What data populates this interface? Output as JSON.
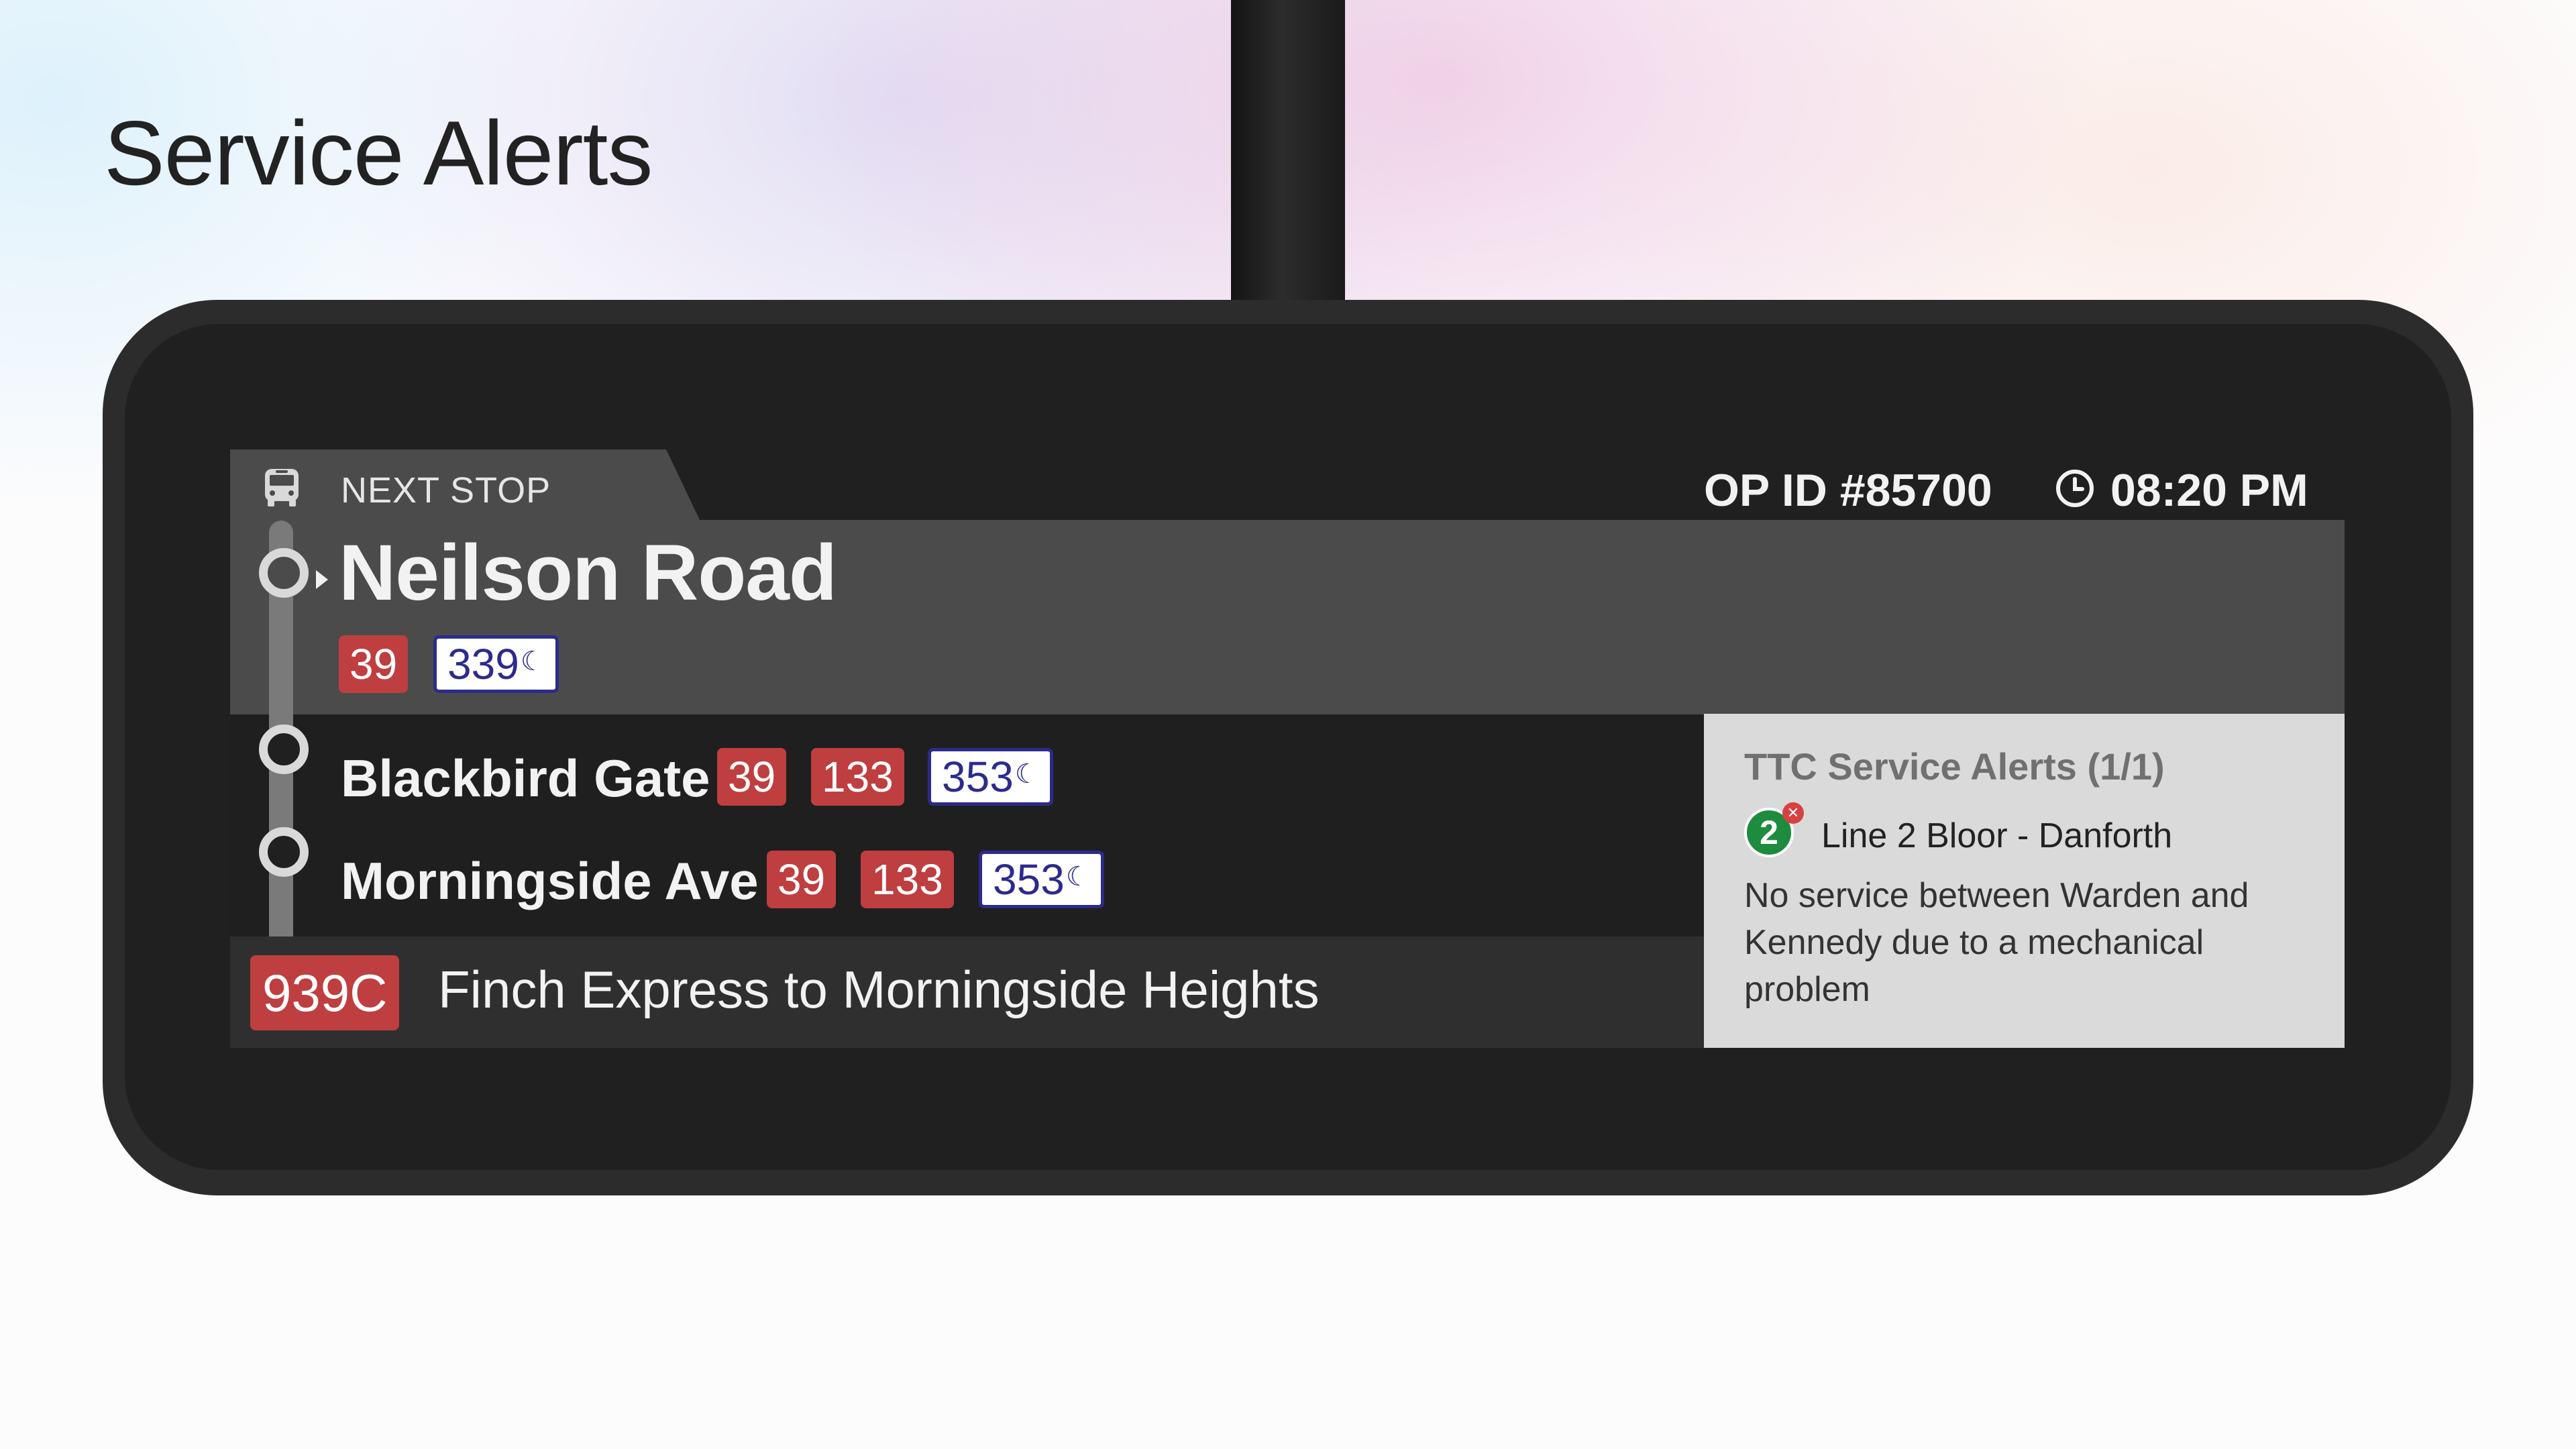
{
  "page": {
    "title": "Service Alerts"
  },
  "header": {
    "next_stop_label": "NEXT STOP",
    "op_id": "OP ID #85700",
    "time": "08:20 PM"
  },
  "next_stop": {
    "name": "Neilson Road",
    "routes": [
      {
        "label": "39",
        "type": "day"
      },
      {
        "label": "339",
        "type": "night"
      }
    ]
  },
  "upcoming_stops": [
    {
      "name": "Blackbird Gate",
      "routes": [
        {
          "label": "39",
          "type": "day"
        },
        {
          "label": "133",
          "type": "day"
        },
        {
          "label": "353",
          "type": "night"
        }
      ]
    },
    {
      "name": "Morningside Ave",
      "routes": [
        {
          "label": "39",
          "type": "day"
        },
        {
          "label": "133",
          "type": "day"
        },
        {
          "label": "353",
          "type": "night"
        }
      ]
    }
  ],
  "route_info": {
    "route_number": "939C",
    "destination": "Finch Express to Morningside Heights"
  },
  "alerts": {
    "title": "TTC Service Alerts (1/1)",
    "line_number": "2",
    "line_name": "Line 2 Bloor - Danforth",
    "message": "No service between Warden and Kennedy due to a mechanical problem"
  },
  "icons": {
    "bus": "bus-icon",
    "clock": "clock-icon",
    "moon": "moon-icon",
    "alert_close": "close-icon"
  },
  "colors": {
    "route_red": "#bf3e40",
    "night_blue": "#2c2b8c",
    "line2_green": "#1d8c3e",
    "panel_dark": "#1f1f1f",
    "panel_grey": "#4b4b4b",
    "alert_bg": "#dadada"
  }
}
